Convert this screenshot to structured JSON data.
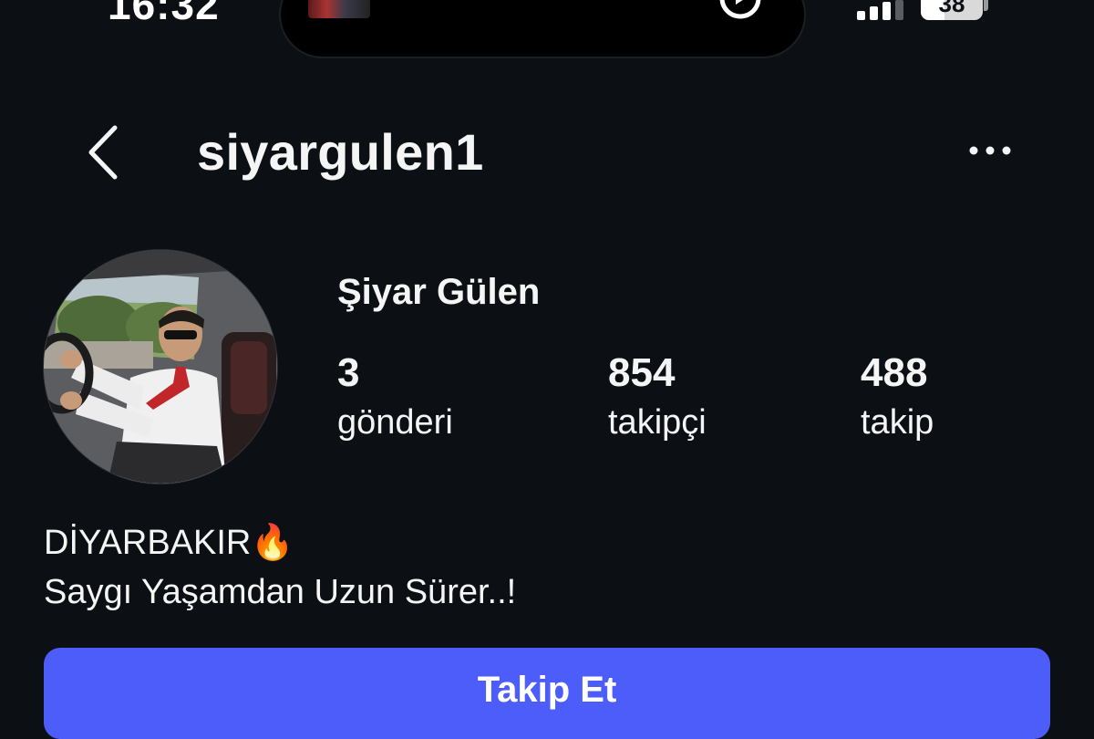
{
  "status_bar": {
    "time": "16:32",
    "battery_level": "38",
    "battery_percent": 38,
    "signal_bars": 3
  },
  "header": {
    "username": "siyargulen1",
    "back_icon": "chevron-left-icon",
    "more_icon": "more-horizontal-icon"
  },
  "profile": {
    "full_name": "Şiyar Gülen",
    "stats": [
      {
        "count": "3",
        "label": "gönderi"
      },
      {
        "count": "854",
        "label": "takipçi"
      },
      {
        "count": "488",
        "label": "takip"
      }
    ],
    "bio": [
      "DİYARBAKIR🔥",
      "Saygı Yaşamdan Uzun Sürer..!"
    ]
  },
  "actions": {
    "follow_label": "Takip Et"
  },
  "colors": {
    "background": "#0c1014",
    "follow_button": "#4d5dfa",
    "text": "#f5f5f5"
  }
}
